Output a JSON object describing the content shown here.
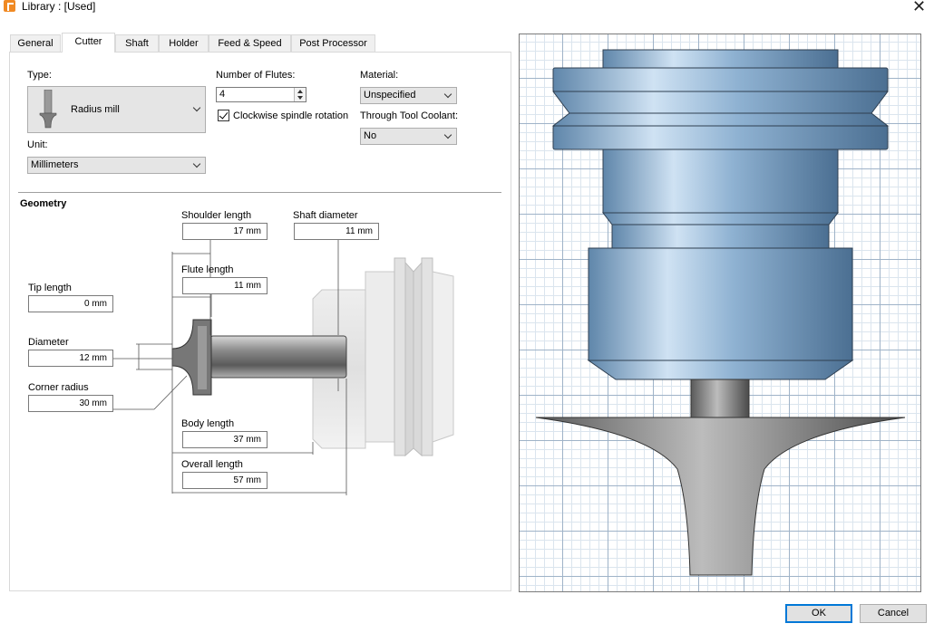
{
  "window": {
    "title": "Library : [Used]"
  },
  "tabs": [
    {
      "label": "General"
    },
    {
      "label": "Cutter"
    },
    {
      "label": "Shaft"
    },
    {
      "label": "Holder"
    },
    {
      "label": "Feed & Speed"
    },
    {
      "label": "Post Processor"
    }
  ],
  "cutter": {
    "type_label": "Type:",
    "type_value": "Radius mill",
    "unit_label": "Unit:",
    "unit_value": "Millimeters",
    "flutes_label": "Number of Flutes:",
    "flutes_value": "4",
    "clockwise_label": "Clockwise spindle rotation",
    "clockwise_checked": true,
    "material_label": "Material:",
    "material_value": "Unspecified",
    "coolant_label": "Through Tool Coolant:",
    "coolant_value": "No"
  },
  "geometry": {
    "heading": "Geometry",
    "shoulder_length": {
      "label": "Shoulder length",
      "value": "17 mm"
    },
    "shaft_diameter": {
      "label": "Shaft diameter",
      "value": "11 mm"
    },
    "flute_length": {
      "label": "Flute length",
      "value": "11 mm"
    },
    "tip_length": {
      "label": "Tip length",
      "value": "0 mm"
    },
    "diameter": {
      "label": "Diameter",
      "value": "12 mm"
    },
    "corner_radius": {
      "label": "Corner radius",
      "value": "30 mm"
    },
    "body_length": {
      "label": "Body length",
      "value": "37 mm"
    },
    "overall_length": {
      "label": "Overall length",
      "value": "57 mm"
    }
  },
  "footer": {
    "ok_label": "OK",
    "cancel_label": "Cancel"
  },
  "colors": {
    "accent": "#0078d7",
    "tool_blue": "#7ea6c9",
    "cutter_gray": "#8a8a8a"
  }
}
